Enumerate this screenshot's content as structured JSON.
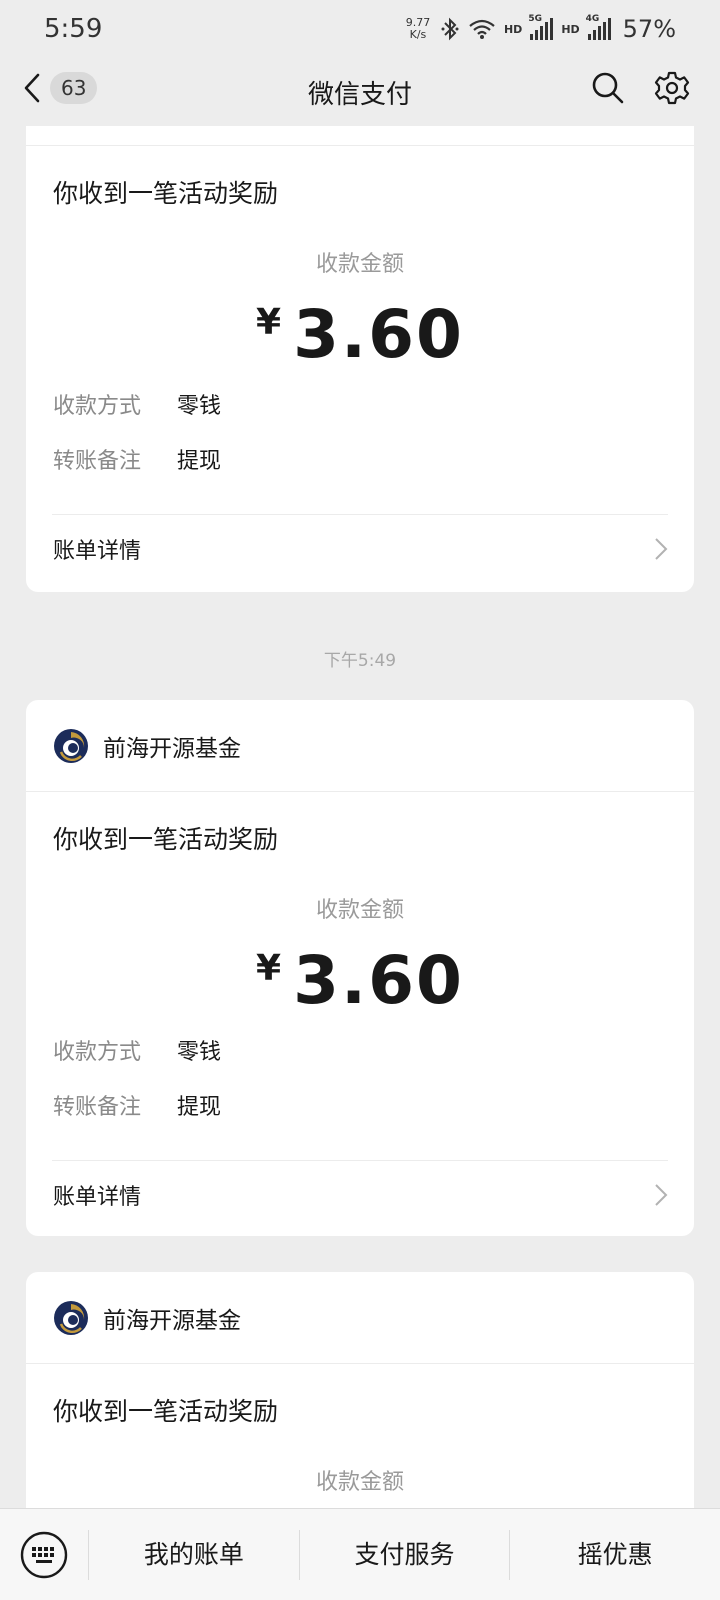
{
  "status_bar": {
    "time": "5:59",
    "net_speed_value": "9.77",
    "net_speed_unit": "K/s",
    "hd1": "HD",
    "sig1_tag": "5G",
    "hd2": "HD",
    "sig2_tag": "4G",
    "battery": "57%"
  },
  "nav": {
    "unread_count": "63",
    "title": "微信支付"
  },
  "labels": {
    "amount_label": "收款金额",
    "method_key": "收款方式",
    "remark_key": "转账备注",
    "bill_detail": "账单详情",
    "currency": "¥"
  },
  "cards": [
    {
      "sender": "",
      "title": "你收到一笔活动奖励",
      "amount": "3.60",
      "method": "零钱",
      "remark": "提现"
    },
    {
      "sender": "前海开源基金",
      "title": "你收到一笔活动奖励",
      "amount": "3.60",
      "method": "零钱",
      "remark": "提现"
    },
    {
      "sender": "前海开源基金",
      "title": "你收到一笔活动奖励"
    }
  ],
  "timestamp": "下午5:49",
  "bottom_menu": {
    "items": [
      "我的账单",
      "支付服务",
      "摇优惠"
    ]
  },
  "colors": {
    "background": "#ededed",
    "card": "#ffffff",
    "logo_navy": "#1c2c5a",
    "logo_gold": "#c49a3c"
  }
}
